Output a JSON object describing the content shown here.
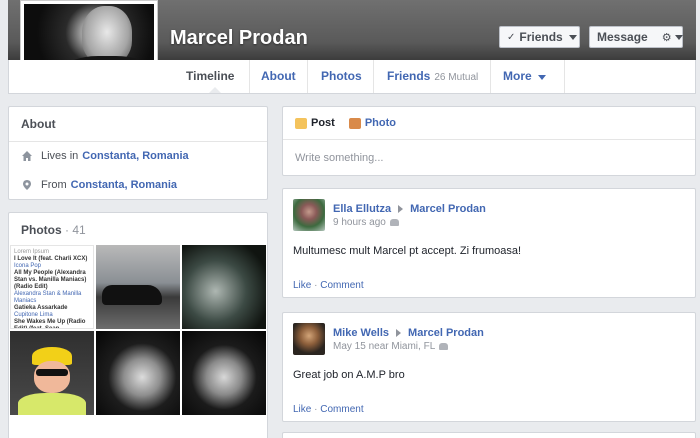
{
  "profile": {
    "name": "Marcel Prodan",
    "friends_button": "Friends",
    "message_button": "Message"
  },
  "nav": {
    "tabs": [
      {
        "label": "Timeline"
      },
      {
        "label": "About"
      },
      {
        "label": "Photos"
      },
      {
        "label": "Friends",
        "sub": "26 Mutual"
      },
      {
        "label": "More"
      }
    ]
  },
  "about": {
    "title": "About",
    "lives_in_label": "Lives in",
    "lives_in_value": "Constanta, Romania",
    "from_label": "From",
    "from_value": "Constanta, Romania"
  },
  "photos": {
    "title": "Photos",
    "count": "· 41",
    "playlist_lines": [
      {
        "text": "Lorem Ipsum",
        "style": "muted"
      },
      {
        "text": "I Love It (feat. Charli XCX)",
        "style": "bold"
      },
      {
        "text": "Icona Pop",
        "style": "link"
      },
      {
        "text": "All My People (Alexandra Stan vs. Manilla Maniacs) (Radio Edit)",
        "style": "bold"
      },
      {
        "text": "Alexandra Stan & Manilla Maniacs",
        "style": "link"
      },
      {
        "text": "Gatieka Assarkade",
        "style": "bold"
      },
      {
        "text": "Cupitone Lima",
        "style": "link"
      },
      {
        "text": "She Wakes Me Up (Radio Edit) (feat. Sean",
        "style": "bold"
      }
    ]
  },
  "composer": {
    "post_tab": "Post",
    "photo_tab": "Photo",
    "placeholder": "Write something..."
  },
  "posts": [
    {
      "author": "Ella Ellutza",
      "target": "Marcel Prodan",
      "meta": "9 hours ago",
      "text": "Multumesc mult Marcel pt accept. Zi frumoasa!",
      "like": "Like",
      "comment": "Comment"
    },
    {
      "author": "Mike Wells",
      "target": "Marcel Prodan",
      "meta": "May 15 near Miami, FL",
      "text": "Great job on A.M.P bro",
      "like": "Like",
      "comment": "Comment"
    }
  ],
  "colors": {
    "link": "#4267b2",
    "background": "#e9ebee",
    "muted": "#90949c"
  }
}
